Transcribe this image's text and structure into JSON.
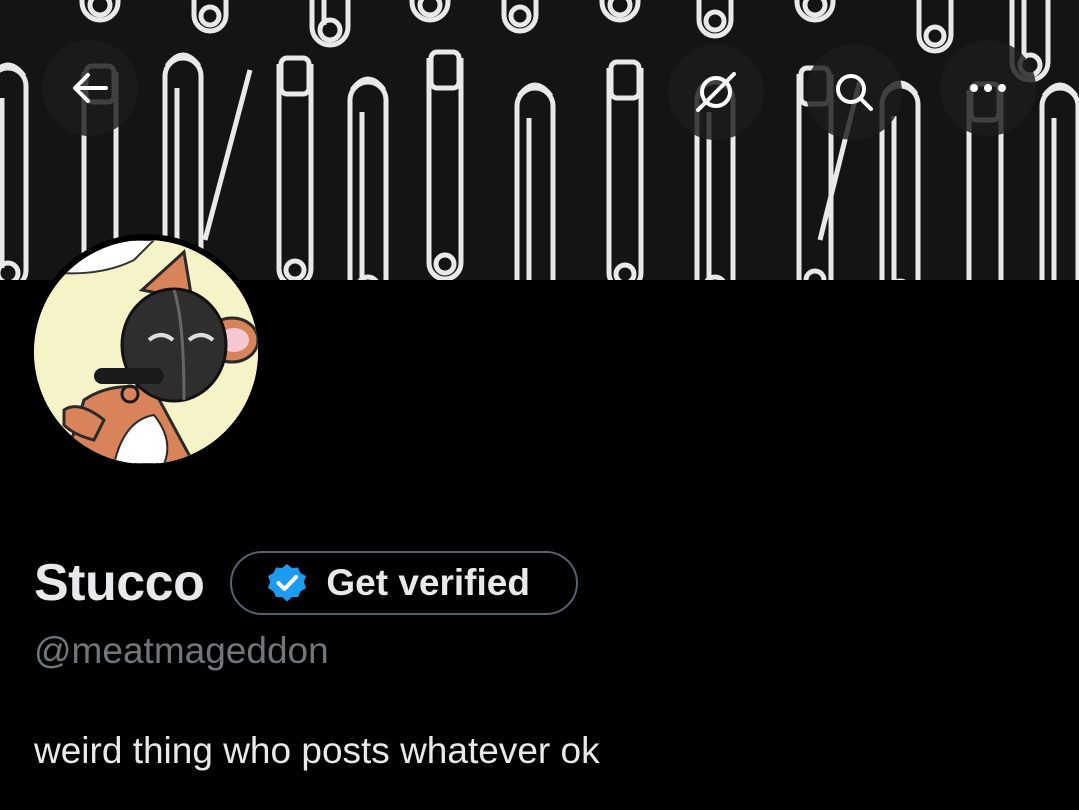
{
  "header": {
    "back_icon": "arrow-left-icon",
    "grok_icon": "grok-icon",
    "search_icon": "search-icon",
    "more_icon": "more-horizontal-icon"
  },
  "banner": {
    "pattern": "white safety pins on black fabric"
  },
  "profile": {
    "display_name": "Stucco",
    "verify_label": "Get verified",
    "verify_icon": "verified-badge-icon",
    "handle": "@meatmageddon",
    "bio": "weird thing who posts whatever ok"
  },
  "colors": {
    "background": "#000000",
    "text_primary": "#e7e9ea",
    "text_secondary": "#71767b",
    "verified_blue": "#1d9bf0",
    "pill_border": "#536471"
  }
}
